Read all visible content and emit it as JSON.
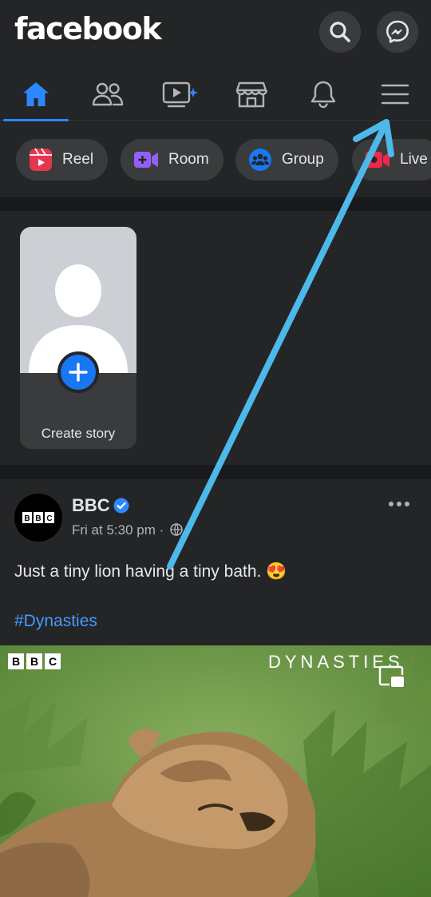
{
  "header": {
    "logo": "facebook",
    "search_icon": "search-icon",
    "messenger_icon": "messenger-icon"
  },
  "nav": {
    "tabs": [
      {
        "icon": "home-icon",
        "active": true
      },
      {
        "icon": "friends-icon",
        "active": false
      },
      {
        "icon": "video-icon",
        "active": false
      },
      {
        "icon": "marketplace-icon",
        "active": false
      },
      {
        "icon": "bell-icon",
        "active": false
      },
      {
        "icon": "menu-icon",
        "active": false
      }
    ]
  },
  "create_chips": [
    {
      "label": "Reel",
      "icon": "reel-icon"
    },
    {
      "label": "Room",
      "icon": "room-icon"
    },
    {
      "label": "Group",
      "icon": "group-icon"
    },
    {
      "label": "Live",
      "icon": "live-icon"
    }
  ],
  "stories": {
    "create_label": "Create story"
  },
  "post": {
    "author": "BBC",
    "avatar_text": "BBC",
    "verified": true,
    "time": "Fri at 5:30 pm ·",
    "text": "Just a tiny lion having a tiny bath. 😍",
    "hashtag": "#Dynasties",
    "media": {
      "watermark_left": "BBC",
      "watermark_right": "DYNASTIES"
    }
  },
  "colors": {
    "accent": "#2d88ff",
    "background": "#18191a",
    "surface": "#242526",
    "annotation_arrow": "#4db8ea"
  }
}
